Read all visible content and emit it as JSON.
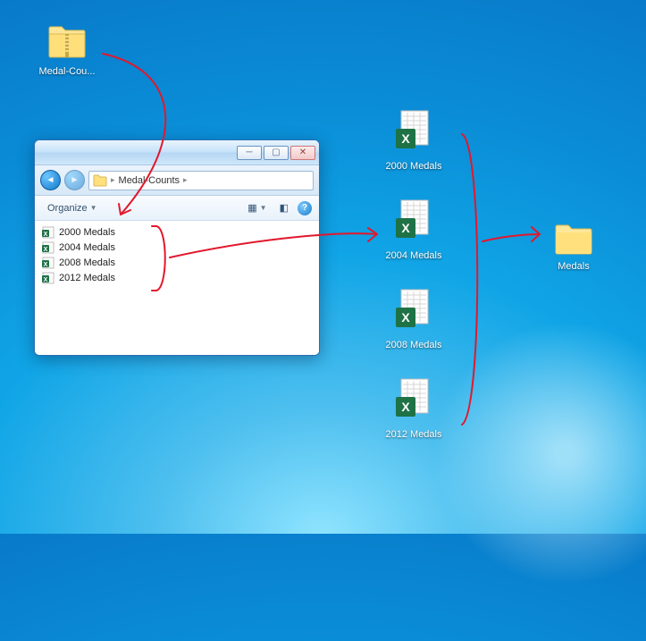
{
  "desktop": {
    "zip_label": "Medal-Cou...",
    "folder_label": "Medals",
    "excel_items": [
      {
        "label": "2000 Medals"
      },
      {
        "label": "2004 Medals"
      },
      {
        "label": "2008 Medals"
      },
      {
        "label": "2012 Medals"
      }
    ]
  },
  "explorer": {
    "breadcrumb": "Medal-Counts",
    "organize_label": "Organize",
    "files": [
      {
        "name": "2000 Medals"
      },
      {
        "name": "2004 Medals"
      },
      {
        "name": "2008 Medals"
      },
      {
        "name": "2012 Medals"
      }
    ]
  }
}
